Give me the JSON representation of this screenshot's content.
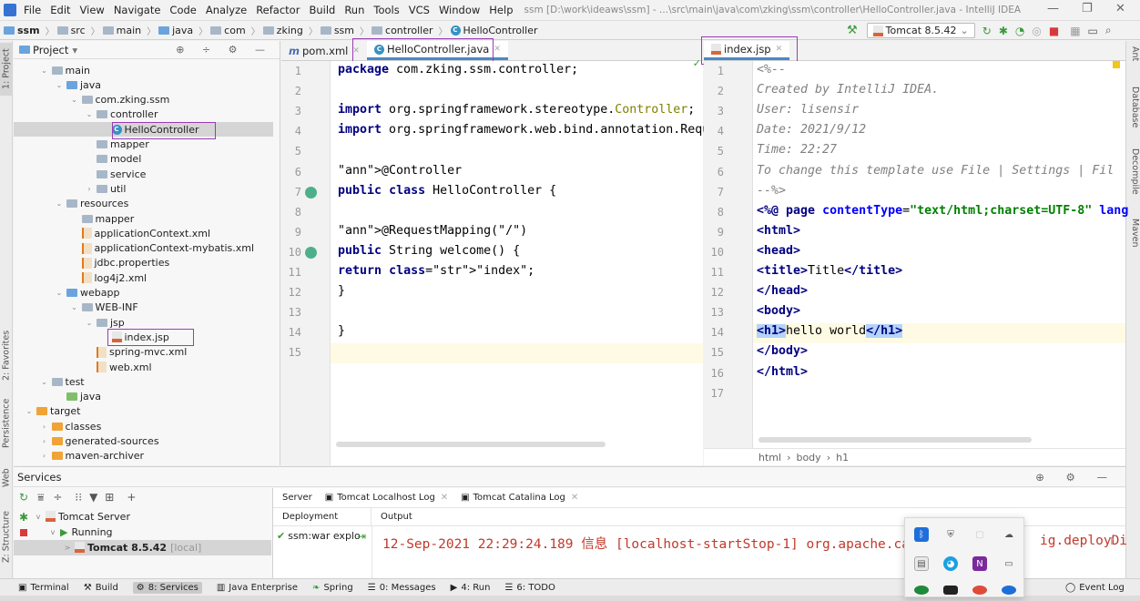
{
  "menu": {
    "items": [
      "File",
      "Edit",
      "View",
      "Navigate",
      "Code",
      "Analyze",
      "Refactor",
      "Build",
      "Run",
      "Tools",
      "VCS",
      "Window",
      "Help"
    ],
    "window_title": "ssm [D:\\work\\ideaws\\ssm] - ...\\src\\main\\java\\com\\zking\\ssm\\controller\\HelloController.java - IntelliJ IDEA"
  },
  "breadcrumbs": [
    "ssm",
    "src",
    "main",
    "java",
    "com",
    "zking",
    "ssm",
    "controller",
    "HelloController"
  ],
  "toolbar": {
    "run_config": "Tomcat 8.5.42"
  },
  "side_tools_left": [
    "1: Project",
    "2: Favorites",
    "Persistence",
    "Web",
    "Z: Structure"
  ],
  "side_tools_right": [
    "Ant",
    "Database",
    "Decompile",
    "Maven"
  ],
  "project": {
    "header": "Project",
    "tree": [
      {
        "label": "main",
        "icon": "folder",
        "depth": 1,
        "arrow": "v"
      },
      {
        "label": "java",
        "icon": "folder-blue",
        "depth": 2,
        "arrow": "v"
      },
      {
        "label": "com.zking.ssm",
        "icon": "folder",
        "depth": 3,
        "arrow": "v"
      },
      {
        "label": "controller",
        "icon": "folder",
        "depth": 4,
        "arrow": "v"
      },
      {
        "label": "HelloController",
        "icon": "class",
        "depth": 5,
        "arrow": ""
      },
      {
        "label": "mapper",
        "icon": "folder",
        "depth": 4,
        "arrow": ""
      },
      {
        "label": "model",
        "icon": "folder",
        "depth": 4,
        "arrow": ""
      },
      {
        "label": "service",
        "icon": "folder",
        "depth": 4,
        "arrow": ""
      },
      {
        "label": "util",
        "icon": "folder",
        "depth": 4,
        "arrow": ">"
      },
      {
        "label": "resources",
        "icon": "folder",
        "depth": 2,
        "arrow": "v"
      },
      {
        "label": "mapper",
        "icon": "folder",
        "depth": 3,
        "arrow": ""
      },
      {
        "label": "applicationContext.xml",
        "icon": "xml",
        "depth": 3,
        "arrow": ""
      },
      {
        "label": "applicationContext-mybatis.xml",
        "icon": "xml",
        "depth": 3,
        "arrow": ""
      },
      {
        "label": "jdbc.properties",
        "icon": "xml",
        "depth": 3,
        "arrow": ""
      },
      {
        "label": "log4j2.xml",
        "icon": "xml",
        "depth": 3,
        "arrow": ""
      },
      {
        "label": "webapp",
        "icon": "folder-blue",
        "depth": 2,
        "arrow": "v"
      },
      {
        "label": "WEB-INF",
        "icon": "folder",
        "depth": 3,
        "arrow": "v"
      },
      {
        "label": "jsp",
        "icon": "folder",
        "depth": 4,
        "arrow": "v"
      },
      {
        "label": "index.jsp",
        "icon": "jsp",
        "depth": 5,
        "arrow": ""
      },
      {
        "label": "spring-mvc.xml",
        "icon": "xml",
        "depth": 4,
        "arrow": ""
      },
      {
        "label": "web.xml",
        "icon": "xml",
        "depth": 4,
        "arrow": ""
      },
      {
        "label": "test",
        "icon": "folder",
        "depth": 1,
        "arrow": "v"
      },
      {
        "label": "java",
        "icon": "folder-green",
        "depth": 2,
        "arrow": ""
      },
      {
        "label": "target",
        "icon": "folder-orange",
        "depth": 0,
        "arrow": "v"
      },
      {
        "label": "classes",
        "icon": "folder-orange",
        "depth": 1,
        "arrow": ">"
      },
      {
        "label": "generated-sources",
        "icon": "folder-orange",
        "depth": 1,
        "arrow": ">"
      },
      {
        "label": "maven-archiver",
        "icon": "folder-orange",
        "depth": 1,
        "arrow": ">"
      }
    ]
  },
  "editor_left": {
    "tabs": [
      "pom.xml",
      "HelloController.java"
    ],
    "lines": [
      "package com.zking.ssm.controller;",
      "",
      "import org.springframework.stereotype.Controller;",
      "import org.springframework.web.bind.annotation.Requ",
      "",
      "@Controller",
      "public class HelloController {",
      "",
      "    @RequestMapping(\"/\")",
      "    public String welcome() {",
      "        return \"index\";",
      "    }",
      "",
      "}",
      ""
    ]
  },
  "editor_right": {
    "tabs": [
      "index.jsp"
    ],
    "lines": [
      "<%--",
      "  Created by IntelliJ IDEA.",
      "  User: lisensir",
      "  Date: 2021/9/12",
      "  Time: 22:27",
      "  To change this template use File | Settings | Fil",
      "--%>",
      "<%@ page contentType=\"text/html;charset=UTF-8\" lang",
      "<html>",
      "<head>",
      "    <title>Title</title>",
      "</head>",
      "<body>",
      "    <h1>hello world</h1>",
      "</body>",
      "</html>",
      ""
    ],
    "breadcrumb": [
      "html",
      "body",
      "h1"
    ]
  },
  "services": {
    "header": "Services",
    "tree": [
      {
        "label": "Tomcat Server",
        "arrow": "v"
      },
      {
        "label": "Running",
        "arrow": "v"
      },
      {
        "label": "Tomcat 8.5.42",
        "suffix": "[local]",
        "arrow": ">"
      }
    ],
    "tabs": [
      "Server",
      "Tomcat Localhost Log",
      "Tomcat Catalina Log"
    ],
    "columns": [
      "Deployment",
      "Output"
    ],
    "deployment": "ssm:war explo",
    "log_line": "12-Sep-2021 22:29:24.189 信息 [localhost-startStop-1] org.apache.catalina.",
    "log_line_tail": "ig.deployDi"
  },
  "statusbar": {
    "items": [
      "Terminal",
      "Build",
      "8: Services",
      "Java Enterprise",
      "Spring",
      "0: Messages",
      "4: Run",
      "6: TODO"
    ],
    "event_log": "Event Log"
  },
  "colors": {
    "accent": "#4a88c7",
    "highlight_box": "#9b3bb5",
    "log_red": "#c0392b"
  }
}
